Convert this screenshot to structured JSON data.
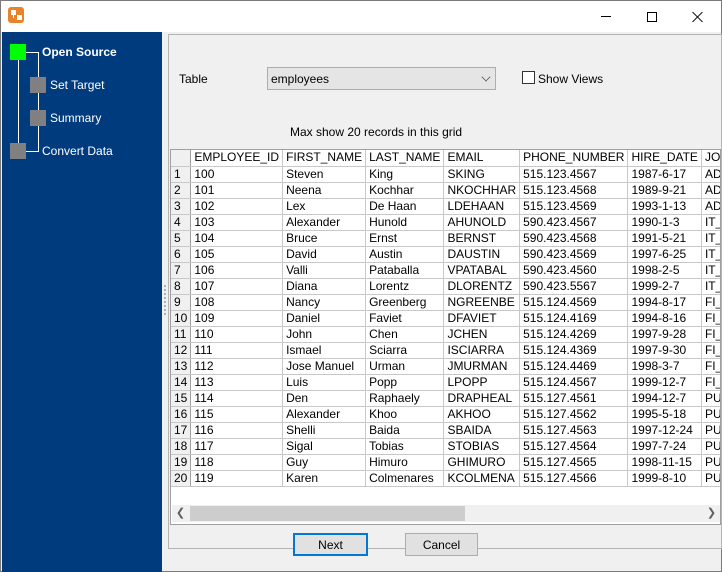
{
  "window": {
    "app_icon": "database-convert-icon",
    "controls": [
      "minimize",
      "maximize",
      "close"
    ]
  },
  "wizard_steps": [
    {
      "label": "Open Source",
      "active": true,
      "color": "#00ff00"
    },
    {
      "label": "Set Target",
      "active": false,
      "color": "#808080"
    },
    {
      "label": "Summary",
      "active": false,
      "color": "#808080"
    },
    {
      "label": "Convert Data",
      "active": false,
      "color": "#808080"
    }
  ],
  "form": {
    "table_label": "Table",
    "table_selected": "employees",
    "show_views_label": "Show Views",
    "show_views_checked": false,
    "max_note": "Max show 20 records in this grid"
  },
  "grid": {
    "columns": [
      "EMPLOYEE_ID",
      "FIRST_NAME",
      "LAST_NAME",
      "EMAIL",
      "PHONE_NUMBER",
      "HIRE_DATE",
      "JOB_ID"
    ],
    "rows": [
      [
        "1",
        "100",
        "Steven",
        "King",
        "SKING",
        "515.123.4567",
        "1987-6-17",
        "AD_PRES"
      ],
      [
        "2",
        "101",
        "Neena",
        "Kochhar",
        "NKOCHHAR",
        "515.123.4568",
        "1989-9-21",
        "AD_VP"
      ],
      [
        "3",
        "102",
        "Lex",
        "De Haan",
        "LDEHAAN",
        "515.123.4569",
        "1993-1-13",
        "AD_VP"
      ],
      [
        "4",
        "103",
        "Alexander",
        "Hunold",
        "AHUNOLD",
        "590.423.4567",
        "1990-1-3",
        "IT_PROG"
      ],
      [
        "5",
        "104",
        "Bruce",
        "Ernst",
        "BERNST",
        "590.423.4568",
        "1991-5-21",
        "IT_PROG"
      ],
      [
        "6",
        "105",
        "David",
        "Austin",
        "DAUSTIN",
        "590.423.4569",
        "1997-6-25",
        "IT_PROG"
      ],
      [
        "7",
        "106",
        "Valli",
        "Pataballa",
        "VPATABAL",
        "590.423.4560",
        "1998-2-5",
        "IT_PROG"
      ],
      [
        "8",
        "107",
        "Diana",
        "Lorentz",
        "DLORENTZ",
        "590.423.5567",
        "1999-2-7",
        "IT_PROG"
      ],
      [
        "9",
        "108",
        "Nancy",
        "Greenberg",
        "NGREENBE",
        "515.124.4569",
        "1994-8-17",
        "FI_MGR"
      ],
      [
        "10",
        "109",
        "Daniel",
        "Faviet",
        "DFAVIET",
        "515.124.4169",
        "1994-8-16",
        "FI_ACCOUNT"
      ],
      [
        "11",
        "110",
        "John",
        "Chen",
        "JCHEN",
        "515.124.4269",
        "1997-9-28",
        "FI_ACCOUNT"
      ],
      [
        "12",
        "111",
        "Ismael",
        "Sciarra",
        "ISCIARRA",
        "515.124.4369",
        "1997-9-30",
        "FI_ACCOUNT"
      ],
      [
        "13",
        "112",
        "Jose Manuel",
        "Urman",
        "JMURMAN",
        "515.124.4469",
        "1998-3-7",
        "FI_ACCOUNT"
      ],
      [
        "14",
        "113",
        "Luis",
        "Popp",
        "LPOPP",
        "515.124.4567",
        "1999-12-7",
        "FI_ACCOUNT"
      ],
      [
        "15",
        "114",
        "Den",
        "Raphaely",
        "DRAPHEAL",
        "515.127.4561",
        "1994-12-7",
        "PU_MAN"
      ],
      [
        "16",
        "115",
        "Alexander",
        "Khoo",
        "AKHOO",
        "515.127.4562",
        "1995-5-18",
        "PU_CLERK"
      ],
      [
        "17",
        "116",
        "Shelli",
        "Baida",
        "SBAIDA",
        "515.127.4563",
        "1997-12-24",
        "PU_CLERK"
      ],
      [
        "18",
        "117",
        "Sigal",
        "Tobias",
        "STOBIAS",
        "515.127.4564",
        "1997-7-24",
        "PU_CLERK"
      ],
      [
        "19",
        "118",
        "Guy",
        "Himuro",
        "GHIMURO",
        "515.127.4565",
        "1998-11-15",
        "PU_CLERK"
      ],
      [
        "20",
        "119",
        "Karen",
        "Colmenares",
        "KCOLMENA",
        "515.127.4566",
        "1999-8-10",
        "PU_CLERK"
      ]
    ],
    "scroll_left_icon": "chevron-left-icon",
    "scroll_right_icon": "chevron-right-icon"
  },
  "buttons": {
    "next_label": "Next",
    "cancel_label": "Cancel"
  }
}
